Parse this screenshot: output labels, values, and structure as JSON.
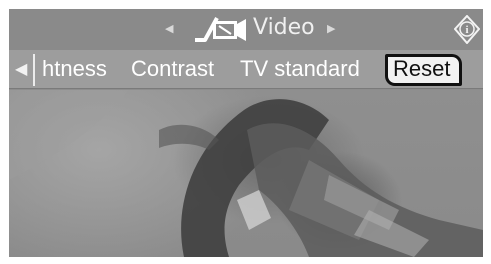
{
  "header": {
    "title": "Video",
    "nav_left_icon": "left-triangle-icon",
    "nav_right_icon": "right-triangle-icon",
    "video_icon": "video-camera-icon",
    "info_icon": "info-icon",
    "info_glyph": "i"
  },
  "menu": {
    "scroll_glyph": "◀",
    "items": [
      {
        "label": "htness"
      },
      {
        "label": "Contrast"
      },
      {
        "label": "TV standard"
      },
      {
        "label": "Reset",
        "selected": true
      }
    ]
  },
  "colors": {
    "header_bg": "#8a8a8a",
    "menu_bg": "#9d9d9d",
    "selected_bg": "#f2f2f2",
    "selected_border": "#111111"
  }
}
